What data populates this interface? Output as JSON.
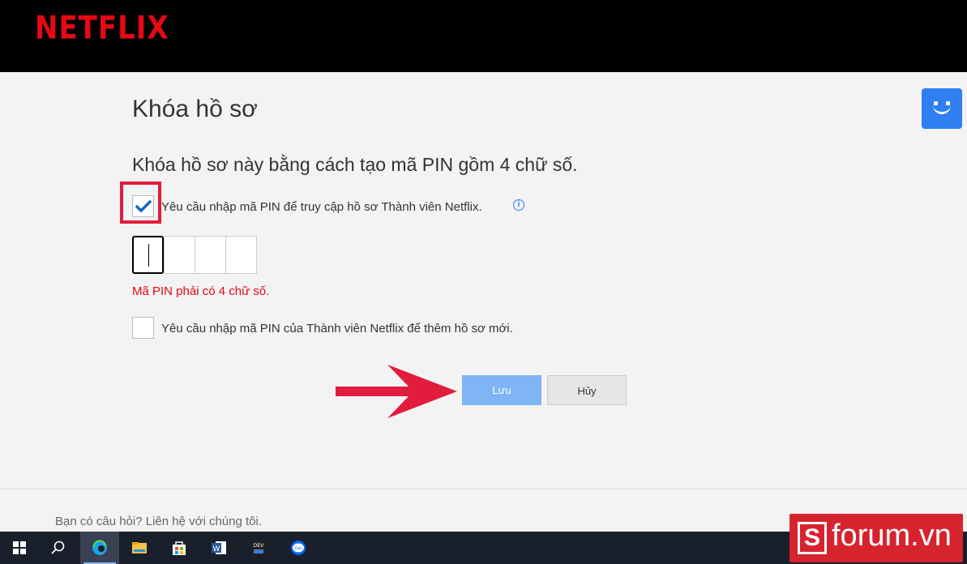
{
  "header": {
    "brand": "NETFLIX"
  },
  "page": {
    "title": "Khóa hồ sơ",
    "subtitle": "Khóa hồ sơ này bằng cách tạo mã PIN gồm 4 chữ số.",
    "require_pin_label": "Yêu cầu nhập mã PIN để truy cập hồ sơ Thành viên Netflix.",
    "require_pin_checked": true,
    "pin_digits": [
      "",
      "",
      "",
      ""
    ],
    "pin_error": "Mã PIN phải có 4 chữ số.",
    "require_pin_new_profile_label": "Yêu cầu nhập mã PIN của Thành viên Netflix để thêm hồ sơ mới.",
    "require_pin_new_profile_checked": false,
    "info_icon": "i"
  },
  "buttons": {
    "save": "Lưu",
    "cancel": "Hủy"
  },
  "footer": {
    "contact": "Bạn có câu hỏi? Liên hệ với chúng tôi."
  },
  "taskbar": {
    "items": [
      "windows-start-icon",
      "search-icon",
      "edge-browser-icon",
      "file-explorer-icon",
      "microsoft-store-icon",
      "word-icon",
      "devtools-icon",
      "zalo-icon"
    ],
    "labels": {
      "word": "W",
      "dev": "DEV",
      "zalo": "Zalo"
    }
  },
  "watermark": {
    "s": "S",
    "text": "forum.vn"
  },
  "colors": {
    "brand": "#e50914",
    "accent": "#2f7ef2",
    "highlight": "#e21c3c"
  }
}
